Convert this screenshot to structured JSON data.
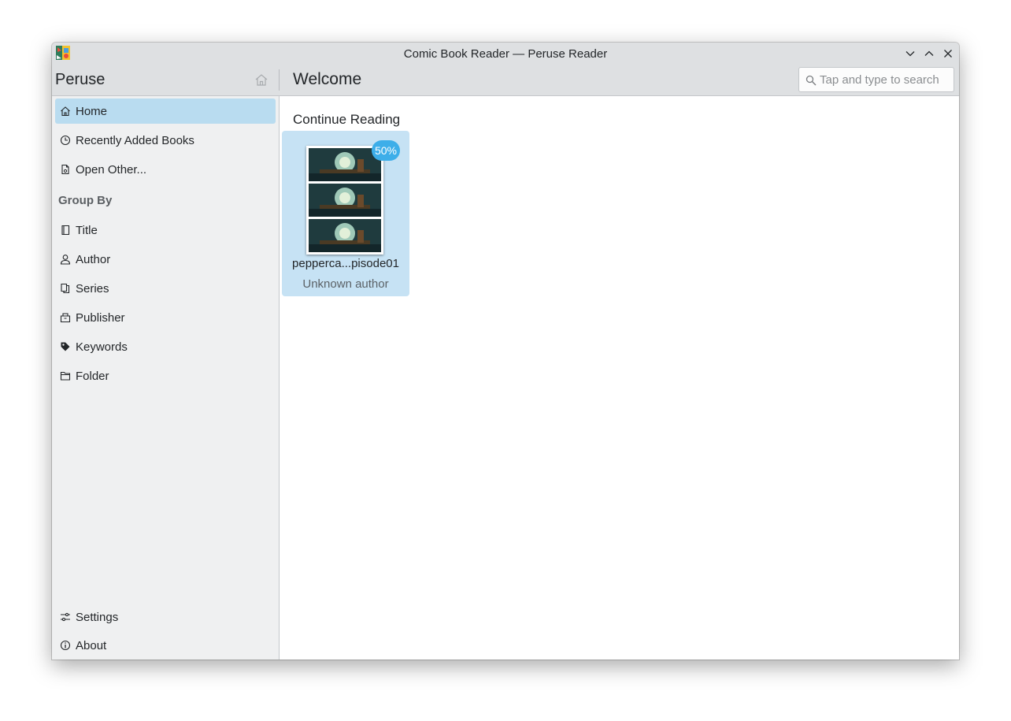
{
  "window": {
    "title": "Comic Book Reader — Peruse Reader"
  },
  "toolbar": {
    "app_name": "Peruse",
    "page_title": "Welcome",
    "search_placeholder": "Tap and type to search"
  },
  "sidebar": {
    "items": [
      {
        "label": "Home",
        "icon": "home-icon",
        "active": true
      },
      {
        "label": "Recently Added Books",
        "icon": "clock-icon"
      },
      {
        "label": "Open Other...",
        "icon": "document-open-icon"
      }
    ],
    "group_by_header": "Group By",
    "group_items": [
      {
        "label": "Title",
        "icon": "title-icon"
      },
      {
        "label": "Author",
        "icon": "user-icon"
      },
      {
        "label": "Series",
        "icon": "series-icon"
      },
      {
        "label": "Publisher",
        "icon": "publisher-icon"
      },
      {
        "label": "Keywords",
        "icon": "tag-icon"
      },
      {
        "label": "Folder",
        "icon": "folder-icon"
      }
    ],
    "bottom_items": [
      {
        "label": "Settings",
        "icon": "settings-icon"
      },
      {
        "label": "About",
        "icon": "info-icon"
      }
    ]
  },
  "main": {
    "section_title": "Continue Reading",
    "books": [
      {
        "title": "pepperca...pisode01",
        "author": "Unknown author",
        "progress_label": "50%",
        "progress": 0.5
      }
    ]
  },
  "colors": {
    "accent": "#3daee9",
    "selection": "#b9dcf0",
    "card_selection": "#c6e2f4",
    "sidebar_bg": "#eff0f1",
    "titlebar_bg": "#dee0e2"
  }
}
